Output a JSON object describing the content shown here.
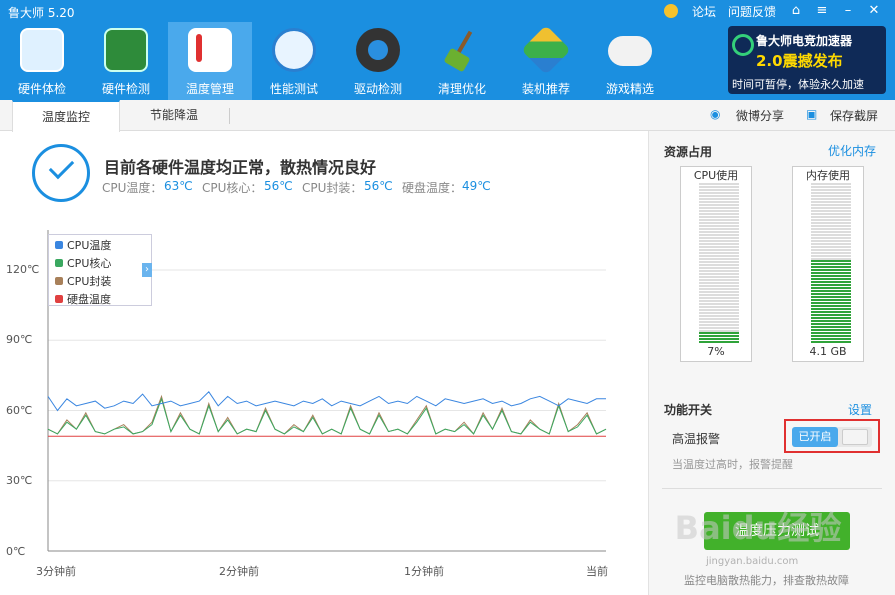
{
  "app": {
    "title": "鲁大师 5.20"
  },
  "topbar": {
    "forum": "论坛",
    "feedback": "问题反馈"
  },
  "nav": [
    {
      "label": "硬件体检",
      "icon": "monitor-icon"
    },
    {
      "label": "硬件检测",
      "icon": "chip-icon"
    },
    {
      "label": "温度管理",
      "icon": "thermometer-icon"
    },
    {
      "label": "性能测试",
      "icon": "speedometer-icon"
    },
    {
      "label": "驱动检测",
      "icon": "gear-icon"
    },
    {
      "label": "清理优化",
      "icon": "broom-icon"
    },
    {
      "label": "装机推荐",
      "icon": "box-icon"
    },
    {
      "label": "游戏精选",
      "icon": "gamepad-icon"
    }
  ],
  "promo": {
    "line1": "鲁大师电竞加速器",
    "line2": "2.0震撼发布",
    "line3": "时间可暂停，体验永久加速"
  },
  "subtabs": {
    "temp": "温度监控",
    "energy": "节能降温"
  },
  "share": {
    "weibo": "微博分享",
    "screenshot": "保存截屏"
  },
  "status": {
    "title": "目前各硬件温度均正常，散热情况良好",
    "cpu_temp_label": "CPU温度：",
    "cpu_temp": "63℃",
    "cpu_core_label": "CPU核心：",
    "cpu_core": "56℃",
    "cpu_pkg_label": "CPU封装：",
    "cpu_pkg": "56℃",
    "disk_label": "硬盘温度：",
    "disk": "49℃"
  },
  "chart_data": {
    "type": "line",
    "y_ticks": [
      "120℃",
      "90℃",
      "60℃",
      "30℃",
      "0℃"
    ],
    "ylim": [
      0,
      120
    ],
    "x_ticks": [
      "3分钟前",
      "2分钟前",
      "1分钟前",
      "当前"
    ],
    "grid": true,
    "legend": "top-left",
    "series": [
      {
        "name": "CPU温度",
        "color": "#3a86e0",
        "values": [
          66,
          60,
          65,
          62,
          63,
          64,
          61,
          62,
          64,
          63,
          67,
          62,
          63,
          64,
          62,
          63,
          64,
          68,
          62,
          66,
          63,
          64,
          62,
          63,
          64,
          63,
          62,
          64,
          63,
          65,
          62,
          64,
          63,
          62,
          64,
          66,
          63,
          64,
          63,
          66,
          64,
          62,
          65,
          64,
          63,
          64,
          65,
          63,
          64,
          62,
          63,
          65,
          66,
          64,
          62,
          65,
          64,
          63,
          65,
          65
        ]
      },
      {
        "name": "CPU核心",
        "color": "#3aa860",
        "values": [
          52,
          50,
          55,
          52,
          58,
          51,
          50,
          52,
          53,
          50,
          51,
          54,
          65,
          51,
          58,
          52,
          50,
          62,
          51,
          56,
          50,
          52,
          51,
          60,
          52,
          50,
          53,
          51,
          57,
          50,
          52,
          50,
          61,
          52,
          50,
          58,
          51,
          52,
          50,
          55,
          61,
          50,
          52,
          51,
          54,
          50,
          58,
          52,
          60,
          51,
          50,
          55,
          52,
          50,
          62,
          51,
          53,
          58,
          50,
          52
        ]
      },
      {
        "name": "CPU封装",
        "color": "#a8805a",
        "values": [
          52,
          50,
          56,
          52,
          59,
          51,
          50,
          52,
          54,
          50,
          51,
          55,
          66,
          51,
          59,
          52,
          50,
          63,
          51,
          57,
          50,
          52,
          51,
          61,
          52,
          50,
          54,
          51,
          58,
          50,
          52,
          50,
          62,
          52,
          50,
          59,
          51,
          52,
          50,
          56,
          62,
          50,
          52,
          51,
          55,
          50,
          59,
          52,
          61,
          51,
          50,
          56,
          52,
          50,
          63,
          51,
          54,
          59,
          50,
          52
        ]
      },
      {
        "name": "硬盘温度",
        "color": "#e04040",
        "values": [
          49,
          49,
          49,
          49,
          49,
          49,
          49,
          49,
          49,
          49,
          49,
          49,
          49,
          49,
          49,
          49,
          49,
          49,
          49,
          49,
          49,
          49,
          49,
          49,
          49,
          49,
          49,
          49,
          49,
          49,
          49,
          49,
          49,
          49,
          49,
          49,
          49,
          49,
          49,
          49,
          49,
          49,
          49,
          49,
          49,
          49,
          49,
          49,
          49,
          49,
          49,
          49,
          49,
          49,
          49,
          49,
          49,
          49,
          49,
          49
        ]
      }
    ]
  },
  "resources": {
    "title": "资源占用",
    "optimize": "优化内存",
    "cpu_label": "CPU使用",
    "cpu_value": "7%",
    "cpu_fraction": 0.07,
    "mem_label": "内存使用",
    "mem_value": "4.1 GB",
    "mem_fraction": 0.52
  },
  "functions": {
    "title": "功能开关",
    "settings": "设置",
    "alarm_label": "高温报警",
    "alarm_state": "已开启",
    "alarm_desc": "当温度过高时，报警提醒"
  },
  "footer": {
    "start_button": "温度压力测试",
    "desc": "监控电脑散热能力，排查散热故障",
    "watermark": "Baidu经验",
    "watermark_sub": "jingyan.baidu.com"
  }
}
